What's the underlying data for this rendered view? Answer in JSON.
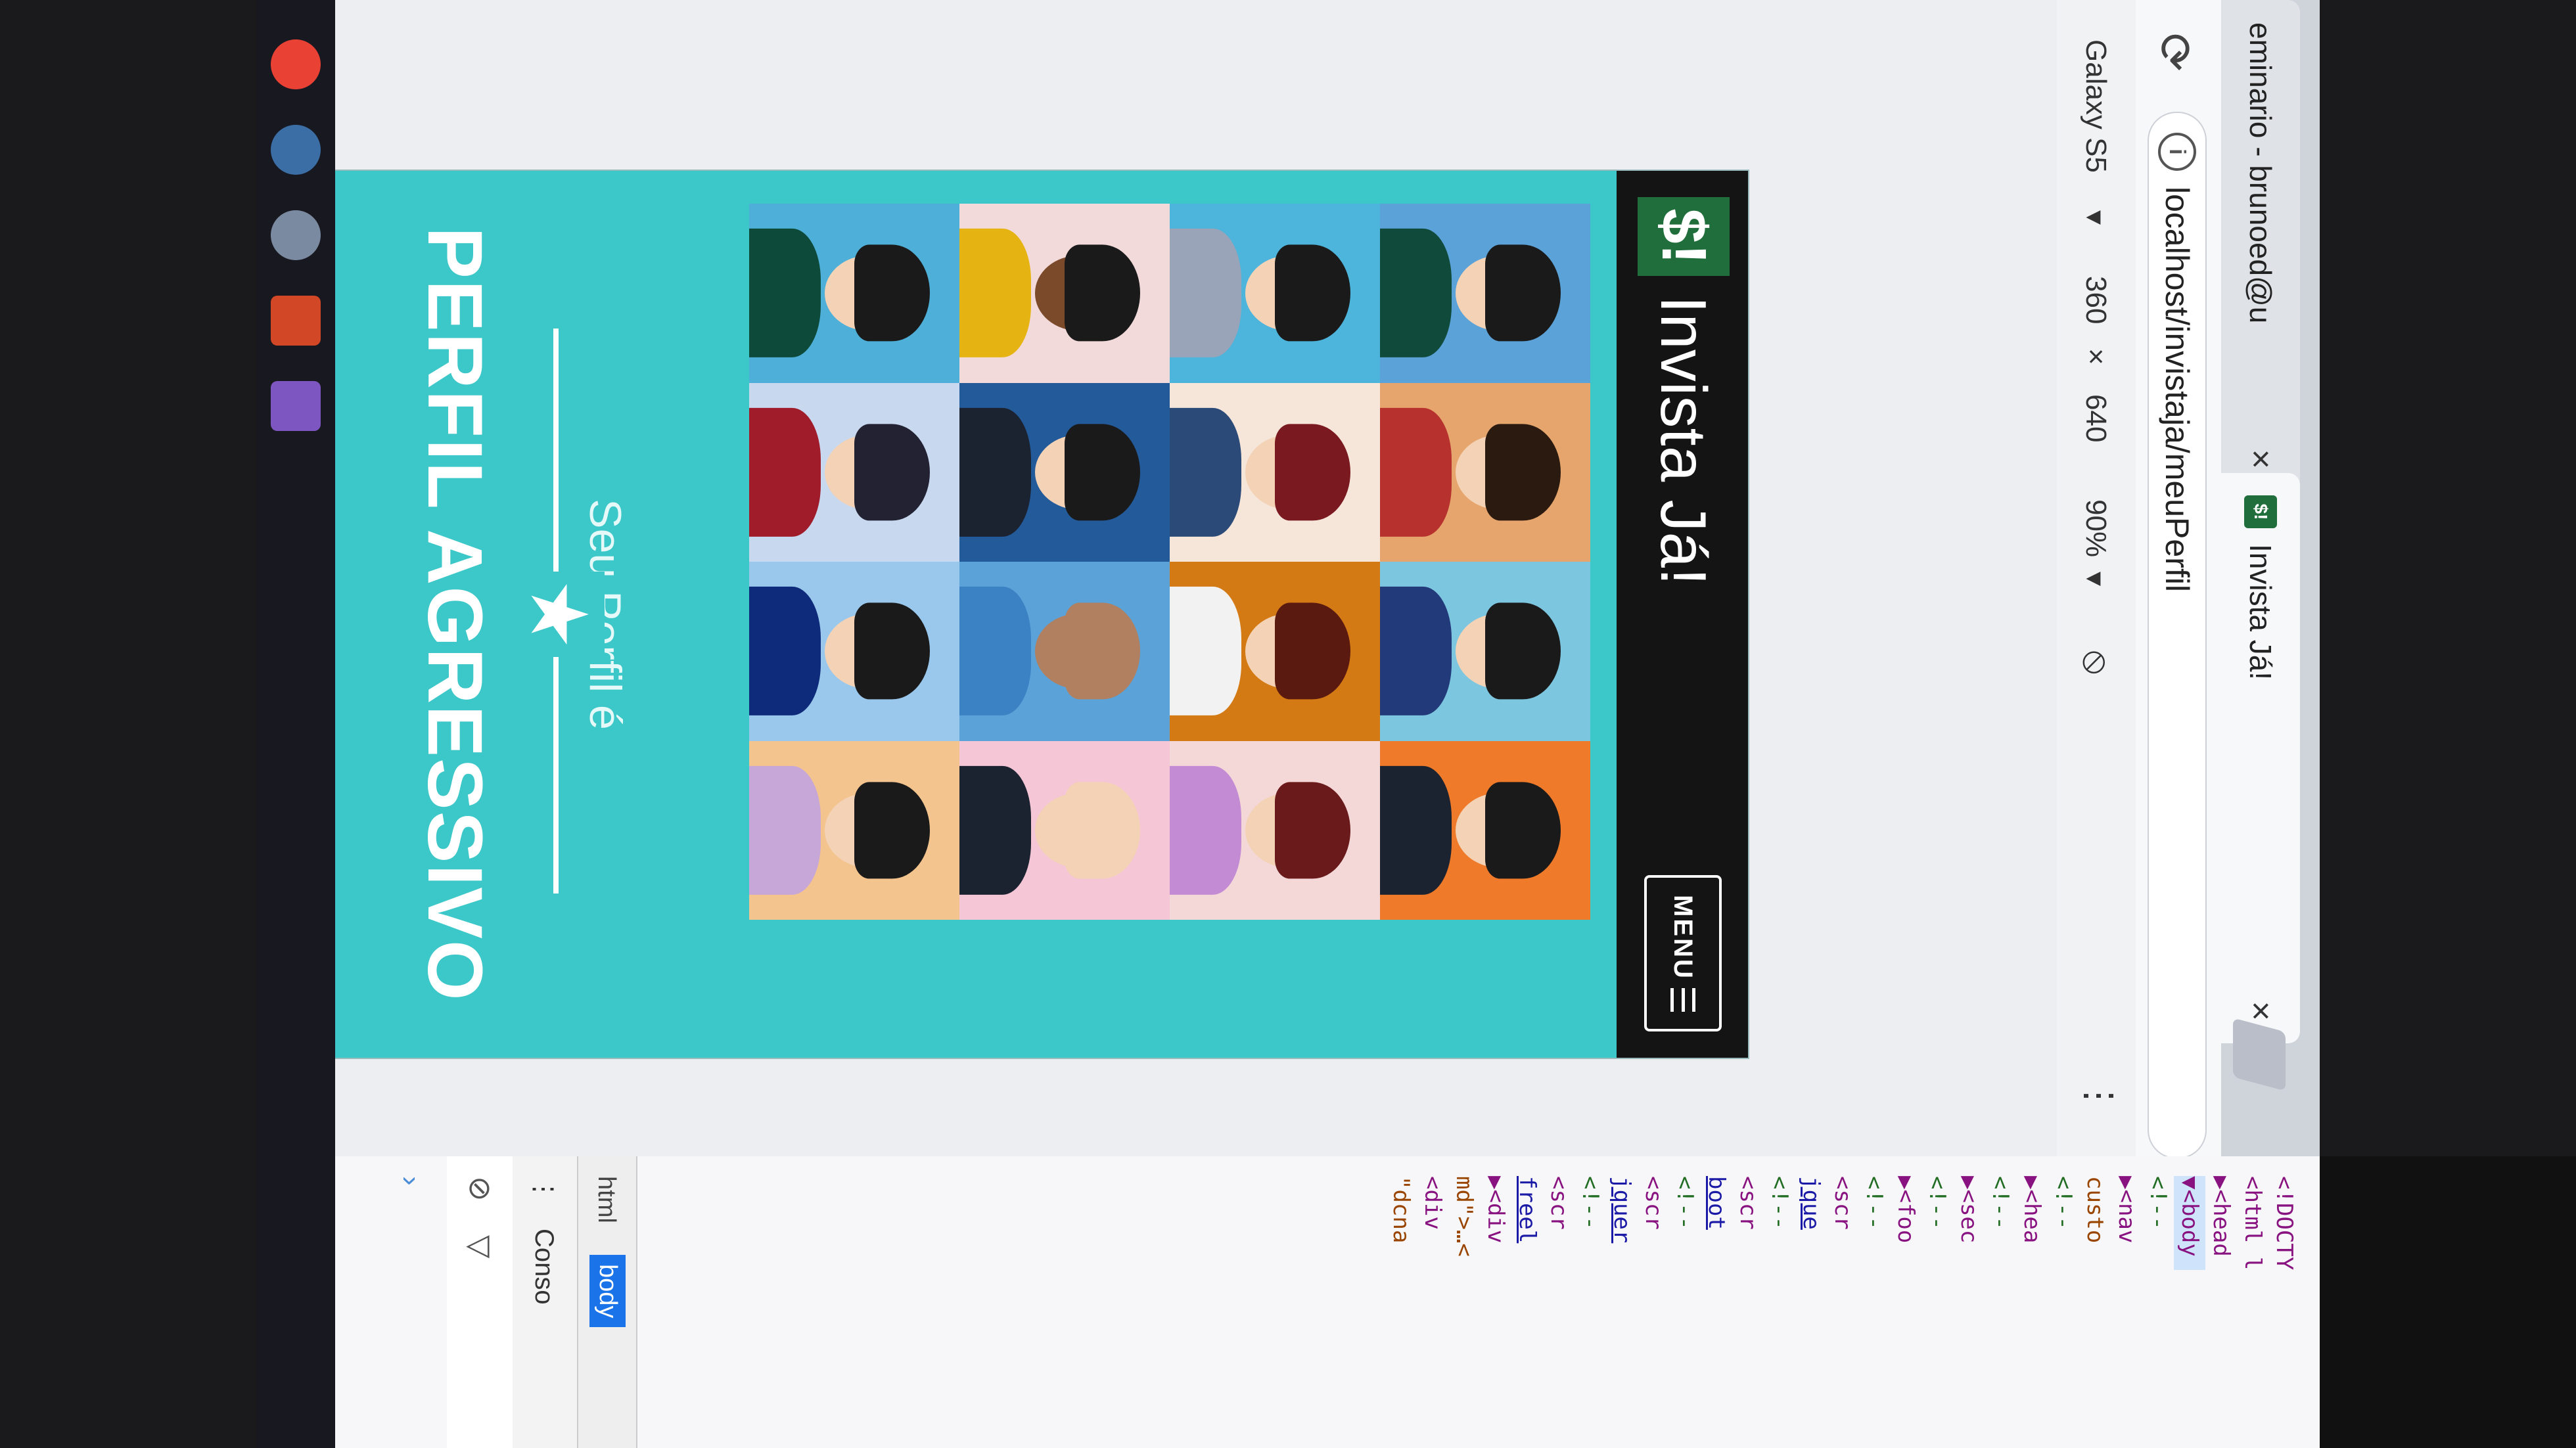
{
  "browser": {
    "inactive_tab_label": "eminario - brunoed@u",
    "active_tab_label": "Invista Já!",
    "active_tab_favicon": "$!",
    "url": "localhost/invistaja/meuPerfil"
  },
  "device_toolbar": {
    "device": "Galaxy S5",
    "width": "360",
    "separator": "×",
    "height": "640",
    "zoom": "90%"
  },
  "app": {
    "brand_logo": "$!",
    "brand_name": "Invista Já!",
    "menu_label": "MENU",
    "profile_label": "Seu Perfil é",
    "profile_value": "PERFIL AGRESSIVO"
  },
  "devtools": {
    "lines": [
      "<!DOCTY",
      "<html l",
      "▶<head",
      "▼<body",
      "<!--",
      "▶<nav",
      "custo",
      "<!--",
      "▶<hea",
      "<!--",
      "▶<sec",
      "<!--",
      "▶<foo",
      "<!--",
      "<scr",
      "jque",
      "<!--",
      "<scr",
      "boot",
      "<!--",
      "<scr",
      "jquer",
      "<!--",
      "<scr",
      "freel",
      "▶<div",
      "md\">…<",
      "<div",
      "\"dcna"
    ],
    "breadcrumb_html": "html",
    "breadcrumb_body": "body",
    "console_tab": "Conso"
  },
  "colors": {
    "brand_green": "#1f6e3c",
    "hero_teal": "#3cc7c9",
    "navbar": "#141414"
  }
}
